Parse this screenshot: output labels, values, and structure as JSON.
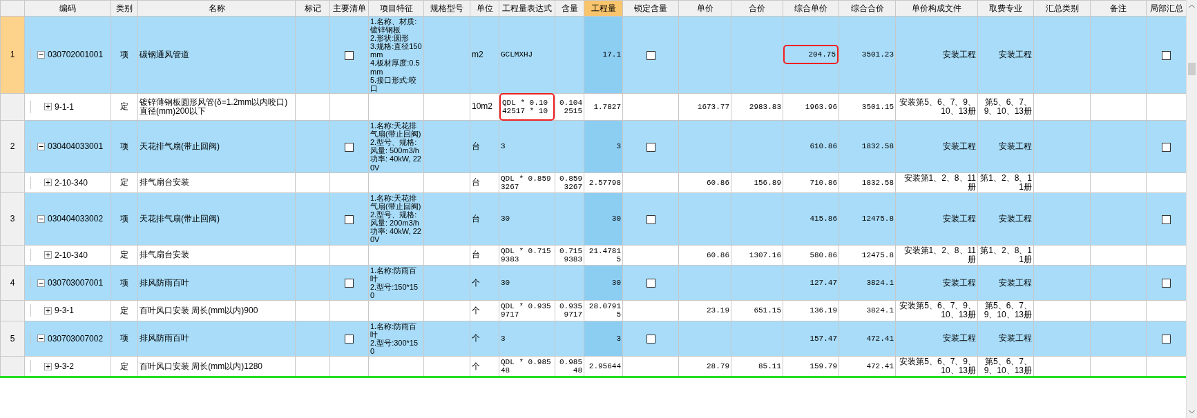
{
  "columns": [
    {
      "label": "编码",
      "selected": false
    },
    {
      "label": "类别",
      "selected": false
    },
    {
      "label": "名称",
      "selected": false
    },
    {
      "label": "标记",
      "selected": false
    },
    {
      "label": "主要清单",
      "selected": false
    },
    {
      "label": "项目特征",
      "selected": false
    },
    {
      "label": "规格型号",
      "selected": false
    },
    {
      "label": "单位",
      "selected": false
    },
    {
      "label": "工程量表达式",
      "selected": false
    },
    {
      "label": "含量",
      "selected": false
    },
    {
      "label": "工程量",
      "selected": true
    },
    {
      "label": "锁定含量",
      "selected": false
    },
    {
      "label": "单价",
      "selected": false
    },
    {
      "label": "合价",
      "selected": false
    },
    {
      "label": "综合单价",
      "selected": false
    },
    {
      "label": "综合合价",
      "selected": false
    },
    {
      "label": "单价构成文件",
      "selected": false
    },
    {
      "label": "取费专业",
      "selected": false
    },
    {
      "label": "汇总类别",
      "selected": false
    },
    {
      "label": "备注",
      "selected": false
    },
    {
      "label": "局部汇总",
      "selected": false
    }
  ],
  "rows": [
    {
      "kind": "item",
      "number": "1",
      "selected": true,
      "expanded": true,
      "cells": [
        "030702001001",
        "项",
        "碳钢通风管道",
        null,
        {
          "checked": false
        },
        "1.名称、材质:镀锌钢板\n2.形状:圆形\n3.规格:直径150mm\n4.板材厚度:0.5mm\n5.接口形式:咬口",
        null,
        "m2",
        "GCLMXHJ",
        null,
        "17.1",
        {
          "checked": false
        },
        null,
        null,
        {
          "text": "204.75",
          "boxed": true
        },
        "3501.23",
        "安装工程",
        "安装工程",
        null,
        null,
        {
          "checked": false
        }
      ]
    },
    {
      "kind": "quota",
      "selected": false,
      "expanded": false,
      "cells": [
        "9-1-1",
        "定",
        "镀锌薄钢板圆形风管(δ=1.2mm以内咬口)直径(mm)200以下",
        null,
        null,
        null,
        null,
        "10m2",
        {
          "text": "QDL * 0.1042517 * 10",
          "boxed": true
        },
        "0.1042515",
        "1.7827",
        null,
        "1673.77",
        "2983.83",
        "1963.96",
        "3501.15",
        "安装第5、6、7、9、10、13册",
        "第5、6、7、9、10、13册",
        null,
        null,
        null
      ]
    },
    {
      "kind": "item",
      "number": "2",
      "selected": false,
      "expanded": true,
      "cells": [
        "030404033001",
        "项",
        "天花排气扇(带止回阀)",
        null,
        {
          "checked": false
        },
        "1.名称:天花排气扇(带止回阀)\n2.型号、规格:风量: 500m3/h  功率: 40kW, 220V",
        null,
        "台",
        "3",
        null,
        "3",
        {
          "checked": false
        },
        null,
        null,
        "610.86",
        "1832.58",
        "安装工程",
        "安装工程",
        null,
        null,
        {
          "checked": false
        }
      ]
    },
    {
      "kind": "quota",
      "selected": false,
      "expanded": false,
      "cells": [
        "2-10-340",
        "定",
        "排气扇台安装",
        null,
        null,
        null,
        null,
        "台",
        "QDL * 0.8593267",
        "0.8593267",
        "2.57798",
        null,
        "60.86",
        "156.89",
        "710.86",
        "1832.58",
        "安装第1、2、8、11册",
        "第1、2、8、11册",
        null,
        null,
        null
      ]
    },
    {
      "kind": "item",
      "number": "3",
      "selected": false,
      "expanded": true,
      "cells": [
        "030404033002",
        "项",
        "天花排气扇(带止回阀)",
        null,
        {
          "checked": false
        },
        "1.名称:天花排气扇(带止回阀)\n2.型号、规格:风量: 200m3/h  功率: 40kW, 220V",
        null,
        "台",
        "30",
        null,
        "30",
        {
          "checked": false
        },
        null,
        null,
        "415.86",
        "12475.8",
        "安装工程",
        "安装工程",
        null,
        null,
        {
          "checked": false
        }
      ]
    },
    {
      "kind": "quota",
      "selected": false,
      "expanded": false,
      "cells": [
        "2-10-340",
        "定",
        "排气扇台安装",
        null,
        null,
        null,
        null,
        "台",
        "QDL * 0.7159383",
        "0.7159383",
        "21.47815",
        null,
        "60.86",
        "1307.16",
        "580.86",
        "12475.8",
        "安装第1、2、8、11册",
        "第1、2、8、11册",
        null,
        null,
        null
      ]
    },
    {
      "kind": "item",
      "number": "4",
      "selected": false,
      "expanded": true,
      "cells": [
        "030703007001",
        "项",
        "排风防雨百叶",
        null,
        {
          "checked": false
        },
        "1.名称:防雨百叶\n2.型号:150*150",
        null,
        "个",
        "30",
        null,
        "30",
        {
          "checked": false
        },
        null,
        null,
        "127.47",
        "3824.1",
        "安装工程",
        "安装工程",
        null,
        null,
        {
          "checked": false
        }
      ]
    },
    {
      "kind": "quota",
      "selected": false,
      "expanded": false,
      "cells": [
        "9-3-1",
        "定",
        "百叶风口安装 周长(mm以内)900",
        null,
        null,
        null,
        null,
        "个",
        "QDL * 0.9359717",
        "0.9359717",
        "28.07915",
        null,
        "23.19",
        "651.15",
        "136.19",
        "3824.1",
        "安装第5、6、7、9、10、13册",
        "第5、6、7、9、10、13册",
        null,
        null,
        null
      ]
    },
    {
      "kind": "item",
      "number": "5",
      "selected": false,
      "expanded": true,
      "cells": [
        "030703007002",
        "项",
        "排风防雨百叶",
        null,
        {
          "checked": false
        },
        "1.名称:防雨百叶\n2.型号:300*150",
        null,
        "个",
        "3",
        null,
        "3",
        {
          "checked": false
        },
        null,
        null,
        "157.47",
        "472.41",
        "安装工程",
        "安装工程",
        null,
        null,
        {
          "checked": false
        }
      ]
    },
    {
      "kind": "quota",
      "selected": false,
      "expanded": false,
      "cells": [
        "9-3-2",
        "定",
        "百叶风口安装 周长(mm以内)1280",
        null,
        null,
        null,
        null,
        "个",
        "QDL * 0.98548",
        "0.98548",
        "2.95644",
        null,
        "28.79",
        "85.11",
        "159.79",
        "472.41",
        "安装第5、6、7、9、10、13册",
        "第5、6、7、9、10、13册",
        null,
        null,
        null
      ]
    }
  ]
}
